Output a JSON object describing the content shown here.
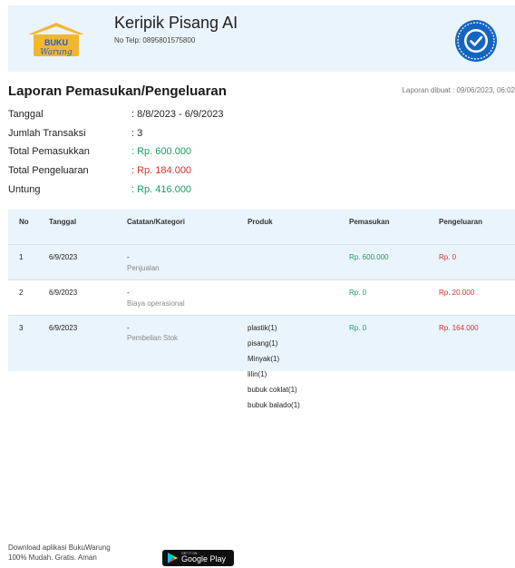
{
  "header": {
    "business_name": "Keripik Pisang AI",
    "phone": "No Telp: 0895801575800",
    "logo_text_top": "BUKU",
    "logo_text_bottom": "Warung"
  },
  "report": {
    "title": "Laporan Pemasukan/Pengeluaran",
    "created": "Laporan dibuat : 09/06/2023, 06:02"
  },
  "summary": [
    {
      "label": "Tanggal",
      "value": ": 8/8/2023 - 6/9/2023",
      "color": "default"
    },
    {
      "label": "Jumlah Transaksi",
      "value": ": 3",
      "color": "default"
    },
    {
      "label": "Total Pemasukkan",
      "value": ": Rp. 600.000",
      "color": "green"
    },
    {
      "label": "Total Pengeluaran",
      "value": ": Rp. 184.000",
      "color": "red"
    },
    {
      "label": "Untung",
      "value": ": Rp. 416.000",
      "color": "green"
    }
  ],
  "table": {
    "headers": [
      "No",
      "Tanggal",
      "Catatan/Kategori",
      "Produk",
      "Pemasukan",
      "Pengeluaran"
    ],
    "rows": [
      {
        "no": "1",
        "date": "6/9/2023",
        "note": "-",
        "category": "Penjualan",
        "products": [],
        "income": "Rp. 600.000",
        "expense": "Rp. 0"
      },
      {
        "no": "2",
        "date": "6/9/2023",
        "note": "-",
        "category": "Biaya operasional",
        "products": [],
        "income": "Rp. 0",
        "expense": "Rp. 20.000"
      },
      {
        "no": "3",
        "date": "6/9/2023",
        "note": "-",
        "category": "Pembelian Stok",
        "products": [
          "plastik(1)",
          "pisang(1)",
          "Minyak(1)",
          "lilin(1)",
          "bubuk coklat(1)",
          "bubuk balado(1)"
        ],
        "income": "Rp. 0",
        "expense": "Rp. 164.000"
      }
    ]
  },
  "footer": {
    "line1": "Download aplikasi BukuWarung",
    "line2": "100% Mudah. Gratis. Aman",
    "store_small": "GET IT ON",
    "store_big": "Google Play"
  },
  "colors": {
    "header_bg": "#eaf4fc",
    "income_green": "#1a9e62",
    "expense_red": "#d9302a",
    "brand_yellow": "#f2b632",
    "brand_blue": "#1565c0"
  }
}
